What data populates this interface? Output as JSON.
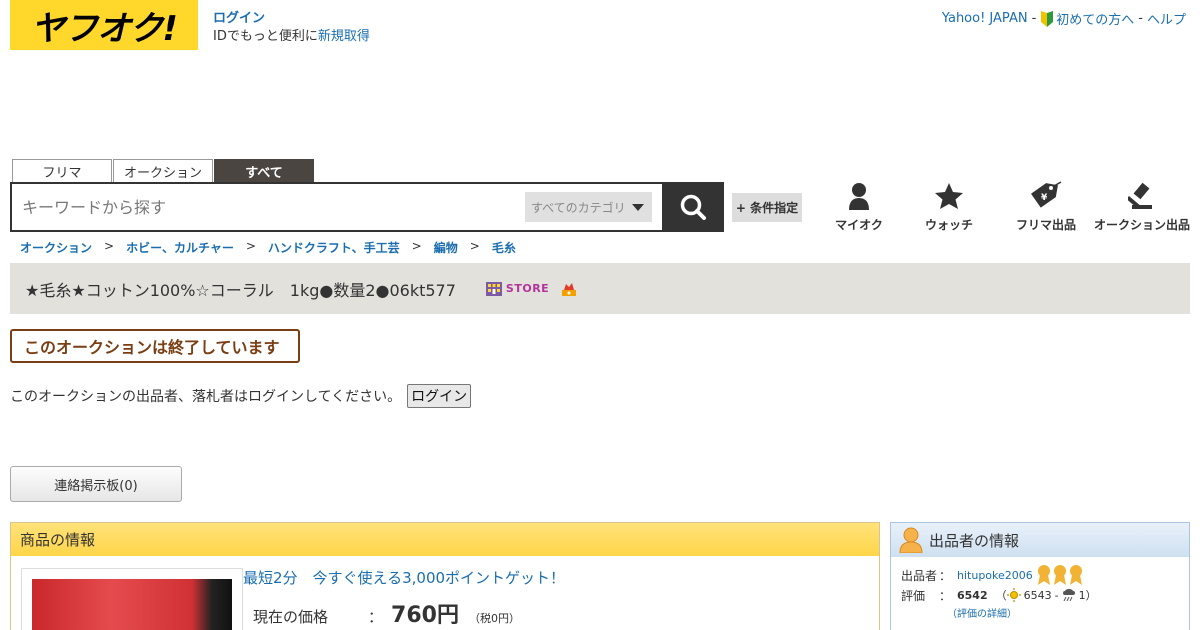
{
  "logo": {
    "text": "ヤフオク!"
  },
  "login": {
    "link": "ログイン",
    "prefix": "IDでもっと便利に",
    "register": "新規取得"
  },
  "top_links": {
    "yahoo_japan": "Yahoo! JAPAN",
    "beginner": "初めての方へ",
    "help": "ヘルプ",
    "sep": "-"
  },
  "tabs": [
    {
      "label": "フリマ"
    },
    {
      "label": "オークション"
    },
    {
      "label": "すべて"
    }
  ],
  "search": {
    "placeholder": "キーワードから探す",
    "category": "すべてのカテゴリ",
    "condition_label": "+ 条件指定"
  },
  "nav": [
    {
      "label": "マイオク",
      "icon": "person-icon"
    },
    {
      "label": "ウォッチ",
      "icon": "star-icon"
    },
    {
      "label": "フリマ出品",
      "icon": "price-tag-icon"
    },
    {
      "label": "オークション出品",
      "icon": "gavel-icon"
    }
  ],
  "breadcrumb": [
    "オークション",
    "ホビー、カルチャー",
    "ハンドクラフト、手工芸",
    "編物",
    "毛糸"
  ],
  "breadcrumb_sep": ">",
  "item": {
    "title": "★毛糸★コットン100%☆コーラル　1kg●数量2●06kt577",
    "store_label": "STORE"
  },
  "ended_banner": "このオークションは終了しています",
  "login_note": {
    "text": "このオークションの出品者、落札者はログインしてください。",
    "button": "ログイン"
  },
  "board_button": "連絡掲示板(0)",
  "item_panel": {
    "header": "商品の情報",
    "promo": "最短2分　今すぐ使える3,000ポイントゲット！",
    "price_label": "現在の価格",
    "price_colon": "：",
    "price": "760円",
    "tax": "（税0円）"
  },
  "seller_panel": {
    "header": "出品者の情報",
    "seller_label": "出品者",
    "seller_name": "hitupoke2006",
    "rating_label": "評価",
    "colon": "：",
    "rating": "6542",
    "rating_open": "（",
    "good": "6543",
    "dash": "-",
    "bad": "1",
    "rating_close": "）",
    "detail_link": "（評価の詳細）"
  },
  "colors": {
    "yahoo_yellow": "#ffd82b",
    "link_blue": "#1a6eb0",
    "ended_brown": "#7a3e14",
    "title_bar_bg": "#e2e1dc"
  }
}
